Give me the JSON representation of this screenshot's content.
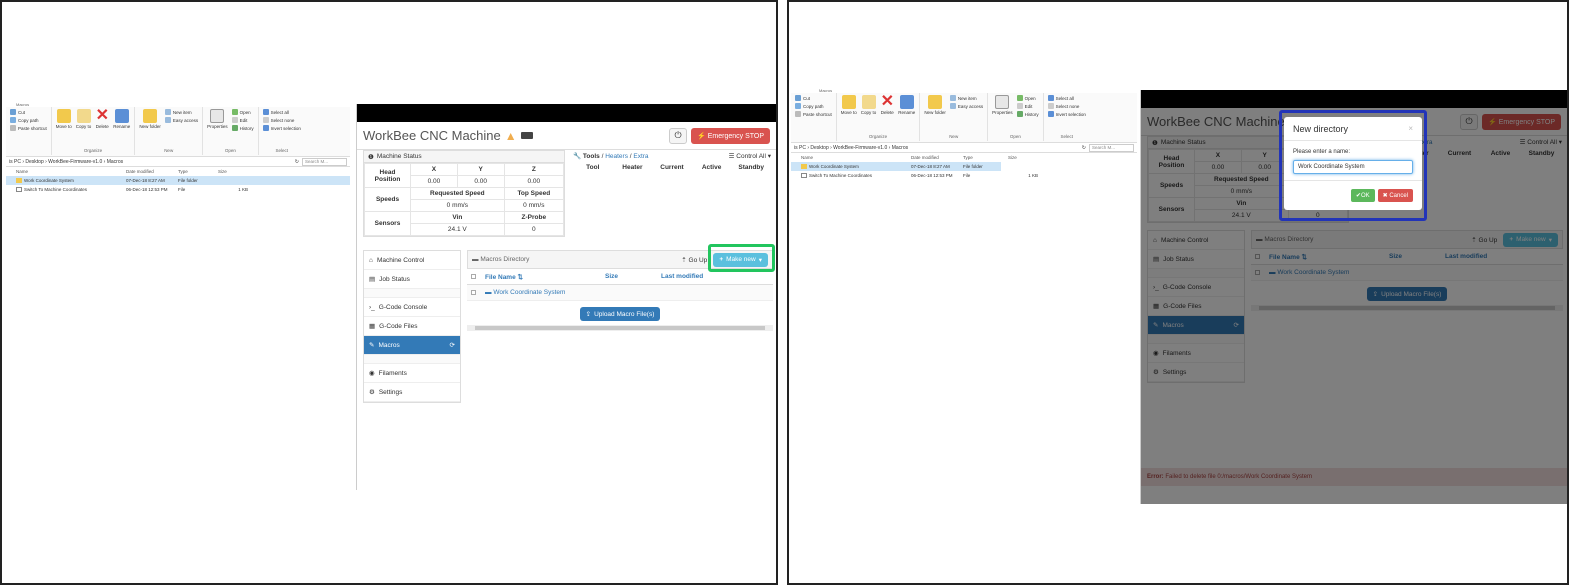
{
  "explorer": {
    "title": "Macros",
    "ribbon": {
      "clipboard": {
        "cut": "Cut",
        "copy_path": "Copy path",
        "paste_shortcut": "Paste shortcut"
      },
      "organize": {
        "move_to": "Move to",
        "copy_to": "Copy to",
        "delete": "Delete",
        "rename": "Rename",
        "label": "Organize"
      },
      "new": {
        "new_folder": "New folder",
        "new_item": "New item",
        "easy_access": "Easy access",
        "label": "New"
      },
      "open": {
        "properties": "Properties",
        "open": "Open",
        "edit": "Edit",
        "history": "History",
        "label": "Open"
      },
      "select": {
        "select_all": "Select all",
        "select_none": "Select none",
        "invert": "Invert selection",
        "label": "Select"
      }
    },
    "path": "is PC  ›  Desktop  ›  WorkBee-Firmware-v1.0  ›  Macros",
    "search_placeholder": "Search M...",
    "columns": {
      "name": "Name",
      "date": "Date modified",
      "type": "Type",
      "size": "Size"
    },
    "files": [
      {
        "name": "Work Coordinate System",
        "date": "07-Dec-18 8:27 AM",
        "type": "File folder",
        "size": ""
      },
      {
        "name": "Switch To Machine Coordinates",
        "date": "06-Dec-18 12:53 PM",
        "type": "File",
        "size": "1 KB"
      }
    ]
  },
  "cnc": {
    "title": "WorkBee CNC Machine",
    "emergency_stop": "Emergency STOP",
    "machine_status": "Machine Status",
    "head_position": "Head Position",
    "axes": [
      "X",
      "Y",
      "Z"
    ],
    "positions": [
      "0.00",
      "0.00",
      "0.00"
    ],
    "speeds_label": "Speeds",
    "requested_speed": "Requested Speed",
    "top_speed": "Top Speed",
    "requested_value": "0 mm/s",
    "top_value": "0 mm/s",
    "sensors_label": "Sensors",
    "vin": "Vin",
    "zprobe": "Z-Probe",
    "vin_value": "24.1 V",
    "zprobe_value": "0",
    "tools_tab": "Tools",
    "heaters_tab": "Heaters",
    "extra_tab": "Extra",
    "control_all": "Control All",
    "tools_columns": [
      "Tool",
      "Heater",
      "Current",
      "Active",
      "Standby"
    ],
    "nav": {
      "machine_control": "Machine Control",
      "job_status": "Job Status",
      "gcode_console": "G-Code Console",
      "gcode_files": "G-Code Files",
      "macros": "Macros",
      "filaments": "Filaments",
      "settings": "Settings"
    },
    "macros_directory": "Macros Directory",
    "go_up": "Go Up",
    "make_new": "Make new",
    "file_name_col": "File Name",
    "size_col": "Size",
    "last_modified_col": "Last modified",
    "macro_folder": "Work Coordinate System",
    "upload": "Upload Macro File(s)"
  },
  "dialog": {
    "title": "New directory",
    "prompt": "Please enter a name:",
    "value": "Work Coordinate System",
    "ok": "OK",
    "cancel": "Cancel"
  },
  "error": {
    "label": "Error:",
    "message": "Failed to delete file 0:/macros/Work Coordinate System"
  },
  "colors": {
    "highlight_green": "#22c55e",
    "highlight_blue": "#2234b8",
    "primary": "#337ab7",
    "danger": "#d9534f"
  }
}
